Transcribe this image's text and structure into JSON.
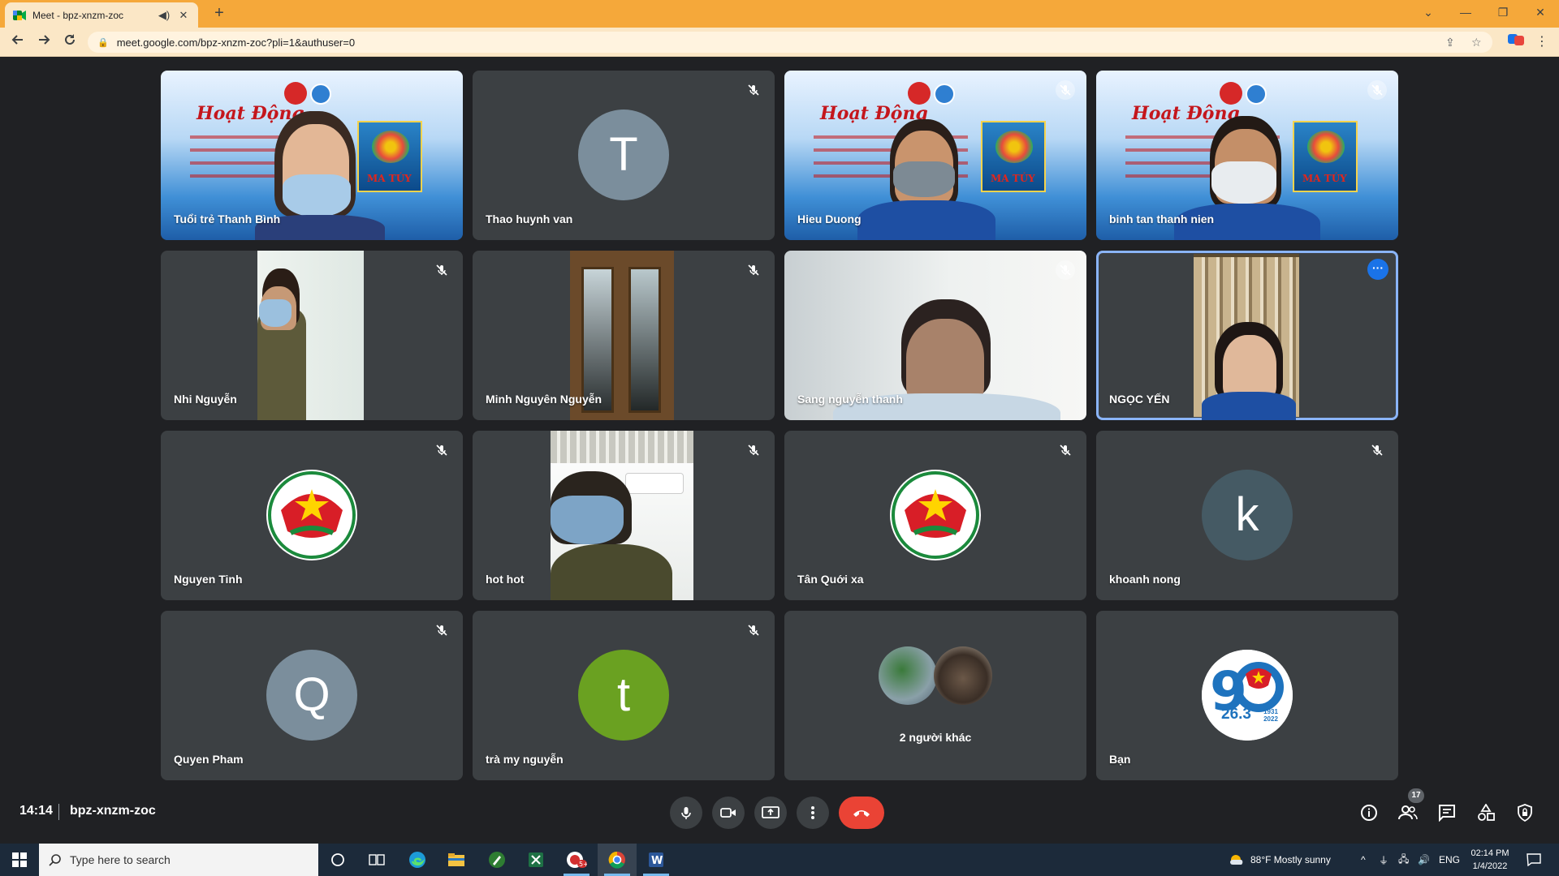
{
  "browser": {
    "tab_title": "Meet - bpz-xnzm-zoc",
    "url": "meet.google.com/bpz-xnzm-zoc?pli=1&authuser=0"
  },
  "tiles": [
    {
      "name": "Tuổi trẻ Thanh Bình"
    },
    {
      "name": "Thao huynh van",
      "initial": "T",
      "color": "#7b8e9c"
    },
    {
      "name": "Hieu Duong"
    },
    {
      "name": "binh tan thanh nien"
    },
    {
      "name": "Nhi Nguyễn"
    },
    {
      "name": "Minh Nguyên Nguyễn"
    },
    {
      "name": "Sang nguyễn thanh"
    },
    {
      "name": "NGỌC YẾN"
    },
    {
      "name": "Nguyen Tinh"
    },
    {
      "name": "hot hot"
    },
    {
      "name": "Tân Quới xa"
    },
    {
      "name": "khoanh nong",
      "initial": "k",
      "color": "#455a64"
    },
    {
      "name": "Quyen Pham",
      "initial": "Q",
      "color": "#7b8e9c"
    },
    {
      "name": "trà my nguyễn",
      "initial": "t",
      "color": "#6aa121"
    },
    {
      "name": "2 người khác"
    },
    {
      "name": "Bạn",
      "logo_text": "26.3",
      "logo_years": "1931 2022"
    }
  ],
  "banner": {
    "title": "Hoạt Động",
    "poster_text": "MA TÚY"
  },
  "meeting": {
    "time": "14:14",
    "code": "bpz-xnzm-zoc",
    "participant_count": "17"
  },
  "taskbar": {
    "search_placeholder": "Type here to search",
    "weather": "88°F  Mostly sunny",
    "lang": "ENG",
    "time": "02:14 PM",
    "date": "1/4/2022"
  },
  "colors": {
    "accent": "#8ab4f8",
    "end_call": "#ea4335",
    "tab_bar": "#f5a83a"
  }
}
